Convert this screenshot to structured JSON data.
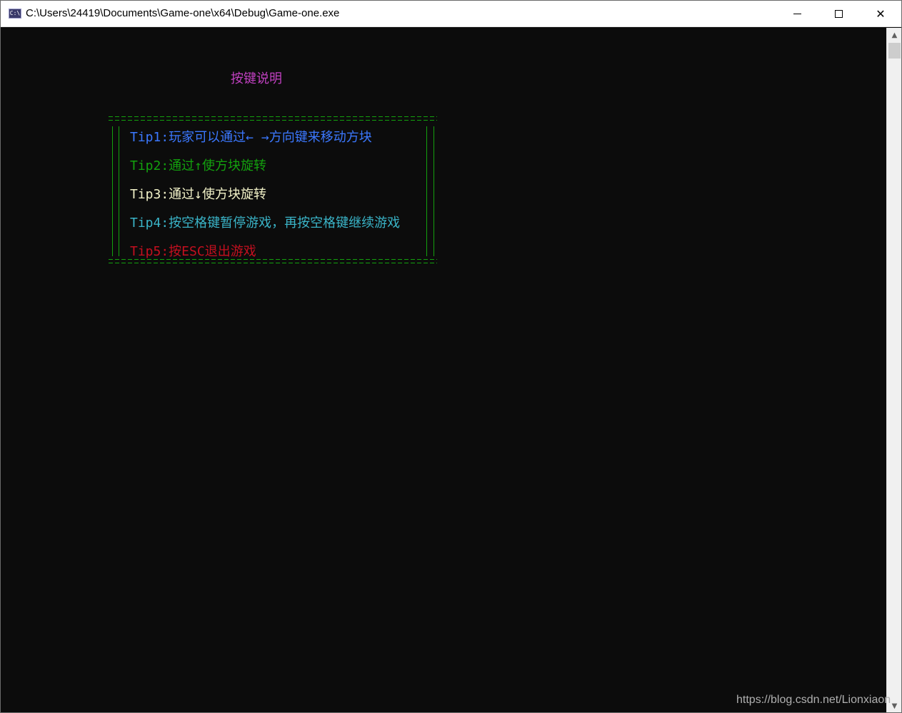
{
  "window": {
    "title": "C:\\Users\\24419\\Documents\\Game-one\\x64\\Debug\\Game-one.exe",
    "icon": "console-app-icon",
    "icon_text": "C:\\",
    "controls": {
      "minimize": "minimize-icon",
      "maximize": "maximize-icon",
      "close": "✕"
    }
  },
  "console": {
    "heading": "按键说明",
    "tips": [
      {
        "text": "Tip1:玩家可以通过←  →方向键来移动方块",
        "color": "#3b78ff"
      },
      {
        "text": "Tip2:通过↑使方块旋转",
        "color": "#13a10e"
      },
      {
        "text": "Tip3:通过↓使方块旋转",
        "color": "#f2f2c8"
      },
      {
        "text": "Tip4:按空格键暂停游戏，再按空格键继续游戏",
        "color": "#3ab4c8"
      },
      {
        "text": "Tip5:按ESC退出游戏",
        "color": "#c50f1f"
      }
    ],
    "heading_color": "#c040c0",
    "border_color": "#13a10e",
    "background": "#0c0c0c"
  },
  "scrollbar": {
    "up": "▲",
    "down": "▼"
  },
  "watermark": "https://blog.csdn.net/Lionxiaon"
}
